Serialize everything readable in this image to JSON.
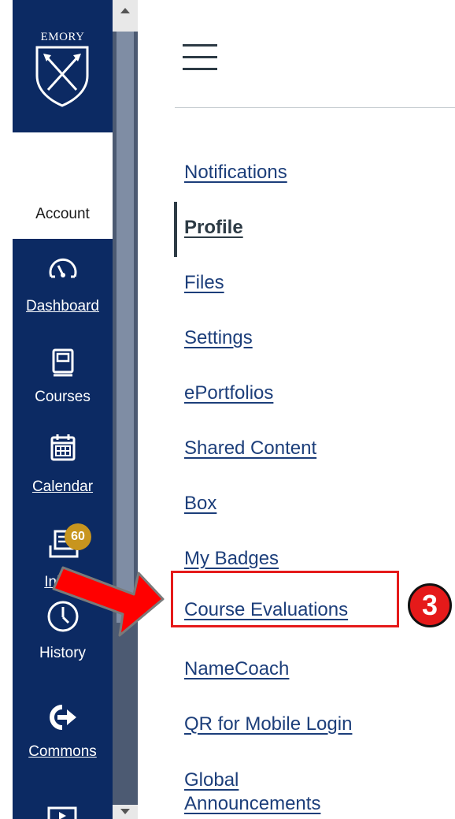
{
  "global_nav": {
    "logo_text": "EMORY",
    "items": [
      {
        "label": "Account",
        "icon": "account-icon",
        "active": true
      },
      {
        "label": "Dashboard",
        "icon": "dashboard-gauge-icon"
      },
      {
        "label": "Courses",
        "icon": "book-icon"
      },
      {
        "label": "Calendar",
        "icon": "calendar-icon"
      },
      {
        "label": "Inbox",
        "icon": "inbox-icon",
        "badge": "60"
      },
      {
        "label": "History",
        "icon": "clock-icon"
      },
      {
        "label": "Commons",
        "icon": "commons-arrow-icon"
      }
    ]
  },
  "account_menu": {
    "links": [
      {
        "label": "Notifications"
      },
      {
        "label": "Profile",
        "active": true
      },
      {
        "label": "Files"
      },
      {
        "label": "Settings"
      },
      {
        "label": "ePortfolios"
      },
      {
        "label": "Shared Content"
      },
      {
        "label": "Box"
      },
      {
        "label": "My Badges"
      },
      {
        "label": "Course Evaluations",
        "highlighted": true
      },
      {
        "label": "NameCoach"
      },
      {
        "label": "QR for Mobile Login"
      },
      {
        "label": "Global",
        "label_line2": "Announcements"
      }
    ]
  },
  "annotation": {
    "step_number": "3",
    "color": "#e51a1a"
  },
  "colors": {
    "nav_background": "#0c2a63",
    "link": "#1c3e7a",
    "badge": "#c8951e"
  }
}
